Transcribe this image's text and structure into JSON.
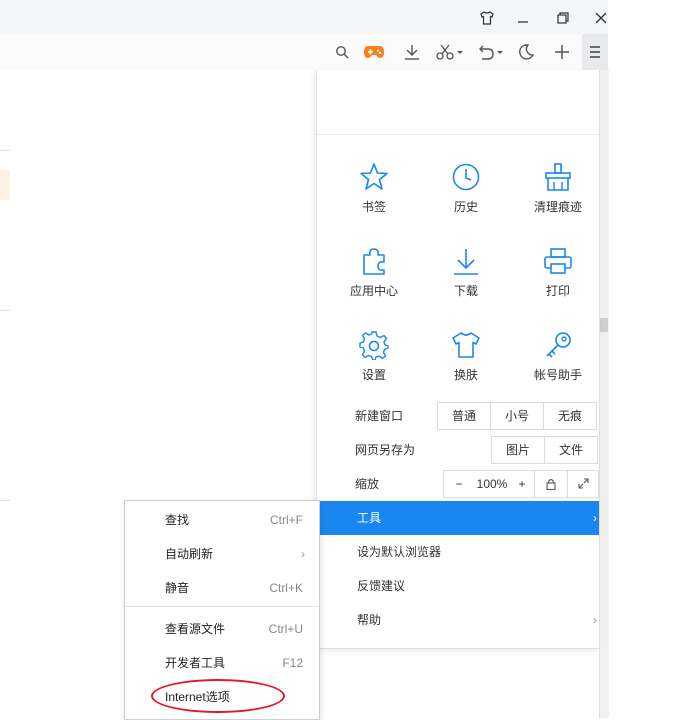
{
  "toolbar": {
    "icons": [
      "search-icon",
      "gamepad-icon",
      "download-icon",
      "scissors-icon",
      "undo-icon",
      "moon-icon",
      "plus-icon",
      "menu-icon"
    ]
  },
  "window": {
    "buttons": [
      "skin-icon",
      "minimize-icon",
      "restore-icon",
      "close-icon"
    ]
  },
  "main_menu": {
    "grid": [
      {
        "label": "书签",
        "icon": "star-icon"
      },
      {
        "label": "历史",
        "icon": "clock-icon"
      },
      {
        "label": "清理痕迹",
        "icon": "broom-icon"
      },
      {
        "label": "应用中心",
        "icon": "puzzle-icon"
      },
      {
        "label": "下载",
        "icon": "download-icon"
      },
      {
        "label": "打印",
        "icon": "printer-icon"
      },
      {
        "label": "设置",
        "icon": "gear-icon"
      },
      {
        "label": "换肤",
        "icon": "tshirt-icon"
      },
      {
        "label": "帐号助手",
        "icon": "key-icon"
      }
    ],
    "new_window": {
      "label": "新建窗口",
      "options": [
        "普通",
        "小号",
        "无痕"
      ]
    },
    "save_as": {
      "label": "网页另存为",
      "options": [
        "图片",
        "文件"
      ]
    },
    "zoom": {
      "label": "缩放",
      "minus": "−",
      "value": "100%",
      "plus": "+"
    },
    "items": [
      {
        "label": "工具",
        "arrow": "›",
        "active": true
      },
      {
        "label": "设为默认浏览器"
      },
      {
        "label": "反馈建议"
      },
      {
        "label": "帮助",
        "arrow": "›"
      }
    ]
  },
  "sub_menu": {
    "items": [
      {
        "label": "查找",
        "shortcut": "Ctrl+F"
      },
      {
        "label": "自动刷新",
        "arrow": "›"
      },
      {
        "label": "静音",
        "shortcut": "Ctrl+K"
      },
      {
        "label": "查看源文件",
        "shortcut": "Ctrl+U"
      },
      {
        "label": "开发者工具",
        "shortcut": "F12"
      },
      {
        "label": "Internet选项"
      }
    ]
  },
  "colors": {
    "accent": "#1a87f0",
    "icon": "#1a87f0",
    "highlight_circle": "#e4182a"
  }
}
